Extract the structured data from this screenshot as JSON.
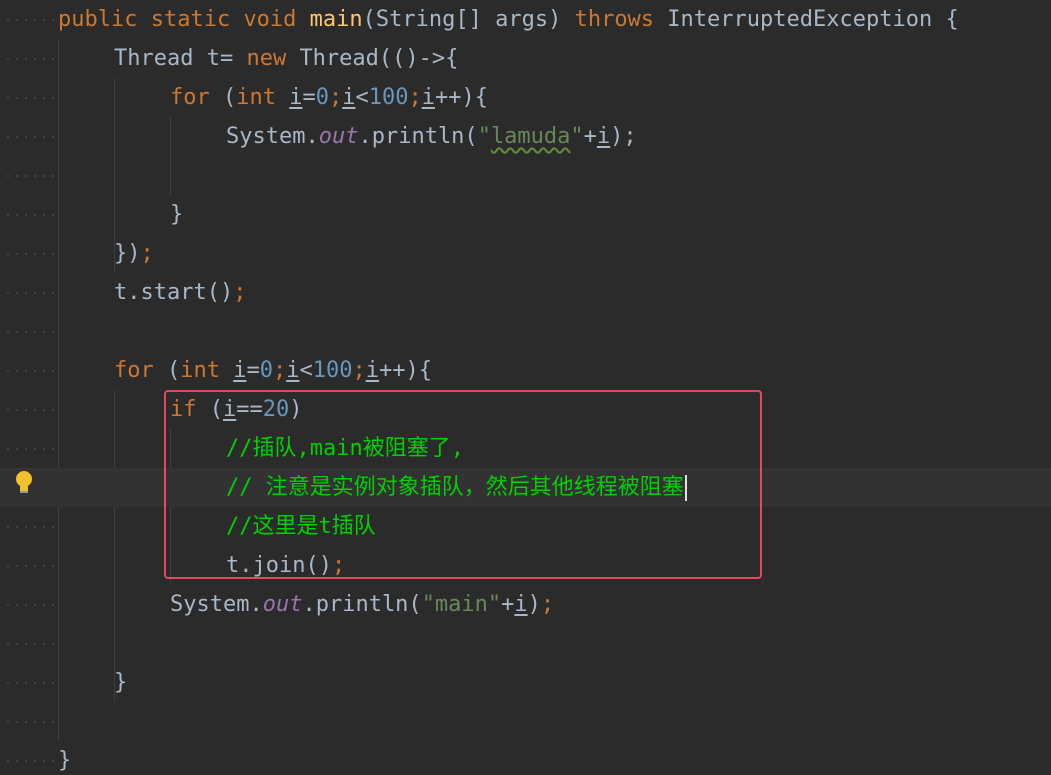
{
  "editor": {
    "lines": [
      {
        "tokens": [
          {
            "t": "public ",
            "c": "kw"
          },
          {
            "t": "static ",
            "c": "kw"
          },
          {
            "t": "void ",
            "c": "kw"
          },
          {
            "t": "main",
            "c": "fn"
          },
          {
            "t": "(String[] args) "
          },
          {
            "t": "throws ",
            "c": "kw"
          },
          {
            "t": "InterruptedException {"
          }
        ]
      },
      {
        "tokens": [
          {
            "t": "Thread t= "
          },
          {
            "t": "new ",
            "c": "kw"
          },
          {
            "t": "Thread(()->{"
          }
        ]
      },
      {
        "tokens": [
          {
            "t": "for ",
            "c": "kw"
          },
          {
            "t": "("
          },
          {
            "t": "int ",
            "c": "kw"
          },
          {
            "t": "i",
            "c": "var"
          },
          {
            "t": "="
          },
          {
            "t": "0",
            "c": "num"
          },
          {
            "t": ";",
            "c": "kw"
          },
          {
            "t": "i",
            "c": "var"
          },
          {
            "t": "<"
          },
          {
            "t": "100",
            "c": "num"
          },
          {
            "t": ";",
            "c": "kw"
          },
          {
            "t": "i",
            "c": "var"
          },
          {
            "t": "++){"
          }
        ]
      },
      {
        "tokens": [
          {
            "t": "System."
          },
          {
            "t": "out",
            "c": "fld"
          },
          {
            "t": ".println("
          },
          {
            "t": "\"",
            "c": "str"
          },
          {
            "t": "lamuda",
            "c": "str typo"
          },
          {
            "t": "\"",
            "c": "str"
          },
          {
            "t": "+"
          },
          {
            "t": "i",
            "c": "var"
          },
          {
            "t": ");"
          },
          {
            "t": "",
            "c": "kw"
          }
        ]
      },
      {
        "tokens": []
      },
      {
        "tokens": [
          {
            "t": "}"
          }
        ]
      },
      {
        "tokens": [
          {
            "t": "})"
          },
          {
            "t": ";",
            "c": "kw"
          }
        ]
      },
      {
        "tokens": [
          {
            "t": "t.start()"
          },
          {
            "t": ";",
            "c": "kw"
          }
        ]
      },
      {
        "tokens": []
      },
      {
        "tokens": [
          {
            "t": "for ",
            "c": "kw"
          },
          {
            "t": "("
          },
          {
            "t": "int ",
            "c": "kw"
          },
          {
            "t": "i",
            "c": "var"
          },
          {
            "t": "="
          },
          {
            "t": "0",
            "c": "num"
          },
          {
            "t": ";",
            "c": "kw"
          },
          {
            "t": "i",
            "c": "var"
          },
          {
            "t": "<"
          },
          {
            "t": "100",
            "c": "num"
          },
          {
            "t": ";",
            "c": "kw"
          },
          {
            "t": "i",
            "c": "var"
          },
          {
            "t": "++){"
          }
        ]
      },
      {
        "tokens": [
          {
            "t": "if ",
            "c": "kw"
          },
          {
            "t": "("
          },
          {
            "t": "i",
            "c": "var"
          },
          {
            "t": "=="
          },
          {
            "t": "20",
            "c": "num"
          },
          {
            "t": ")"
          }
        ]
      },
      {
        "tokens": [
          {
            "t": "//插队,main被阻塞了,",
            "c": "cmt"
          }
        ]
      },
      {
        "tokens": [
          {
            "t": "// 注意是实例对象插队，然后其他线程被阻塞",
            "c": "cmt"
          }
        ],
        "caret": true
      },
      {
        "tokens": [
          {
            "t": "//这里是t插队",
            "c": "cmt"
          }
        ]
      },
      {
        "tokens": [
          {
            "t": "t.join()"
          },
          {
            "t": ";",
            "c": "kw"
          }
        ]
      },
      {
        "tokens": [
          {
            "t": "System."
          },
          {
            "t": "out",
            "c": "fld"
          },
          {
            "t": ".println("
          },
          {
            "t": "\"main\"",
            "c": "str"
          },
          {
            "t": "+"
          },
          {
            "t": "i",
            "c": "var"
          },
          {
            "t": ")"
          },
          {
            "t": ";",
            "c": "kw"
          }
        ]
      },
      {
        "tokens": []
      },
      {
        "tokens": [
          {
            "t": "}"
          }
        ]
      },
      {
        "tokens": []
      },
      {
        "tokens": [
          {
            "t": "}"
          }
        ]
      }
    ],
    "current_line": 12,
    "intention_icon": "lightbulb-icon",
    "colors": {
      "background": "#2b2b2b",
      "keyword": "#cc7832",
      "function": "#ffc66d",
      "string": "#6a8759",
      "number": "#6897bb",
      "field": "#9876aa",
      "comment": "#00d000",
      "highlight_box": "#e8475f"
    }
  }
}
